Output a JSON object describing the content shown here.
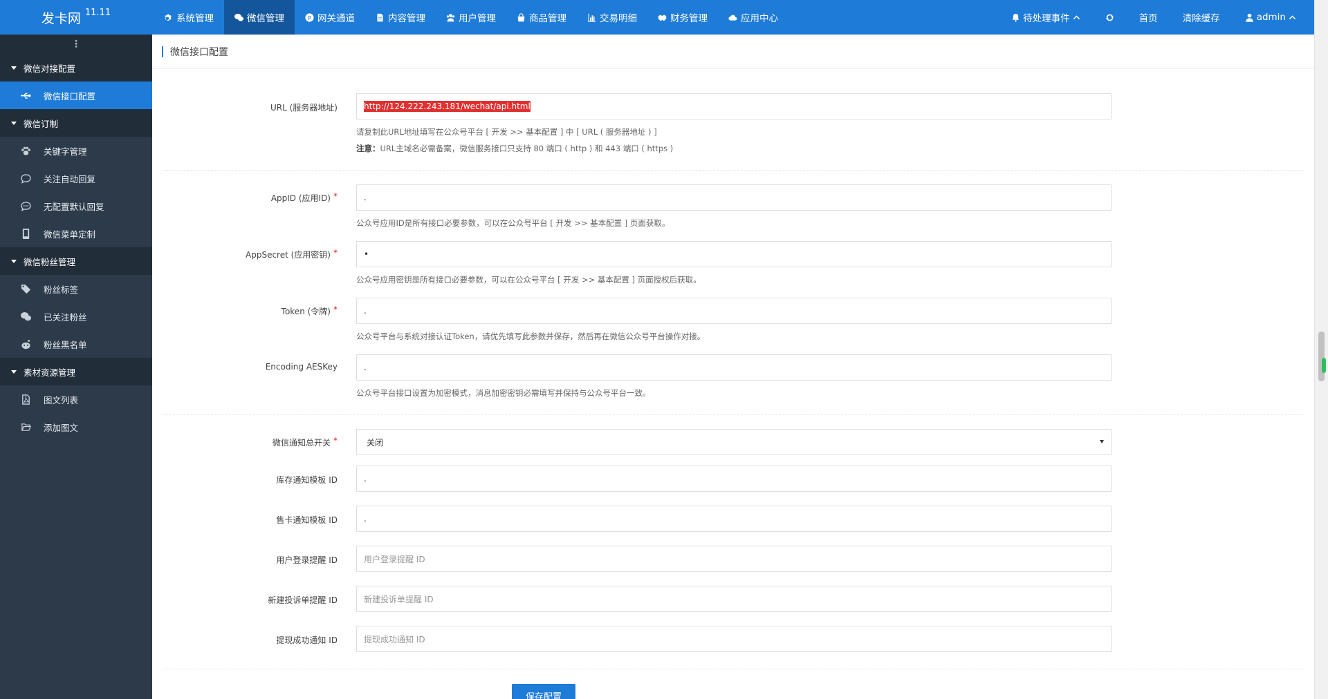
{
  "brand": {
    "name": "发卡网",
    "version": "11.11"
  },
  "topnav": [
    {
      "label": "系统管理",
      "icon": "gear-icon"
    },
    {
      "label": "微信管理",
      "icon": "wechat-icon",
      "active": true
    },
    {
      "label": "网关通道",
      "icon": "paypal-icon"
    },
    {
      "label": "内容管理",
      "icon": "file-text-icon"
    },
    {
      "label": "用户管理",
      "icon": "users-icon"
    },
    {
      "label": "商品管理",
      "icon": "shopping-bag-icon"
    },
    {
      "label": "交易明细",
      "icon": "bar-chart-icon"
    },
    {
      "label": "财务管理",
      "icon": "handshake-icon"
    },
    {
      "label": "应用中心",
      "icon": "cloud-icon"
    }
  ],
  "rightnav": {
    "pending": "待处理事件",
    "home": "首页",
    "clear_cache": "清除缓存",
    "user": "admin"
  },
  "sidebar": {
    "toggle": "⋮",
    "groups": [
      {
        "label": "微信对接配置",
        "items": [
          {
            "label": "微信接口配置",
            "icon": "usb-icon",
            "active": true
          }
        ]
      },
      {
        "label": "微信订制",
        "items": [
          {
            "label": "关键字管理",
            "icon": "paw-icon"
          },
          {
            "label": "关注自动回复",
            "icon": "comment-icon"
          },
          {
            "label": "无配置默认回复",
            "icon": "comment-dots-icon"
          },
          {
            "label": "微信菜单定制",
            "icon": "mobile-icon"
          }
        ]
      },
      {
        "label": "微信粉丝管理",
        "items": [
          {
            "label": "粉丝标签",
            "icon": "tags-icon"
          },
          {
            "label": "已关注粉丝",
            "icon": "wechat-icon"
          },
          {
            "label": "粉丝黑名单",
            "icon": "reddit-icon"
          }
        ]
      },
      {
        "label": "素材资源管理",
        "items": [
          {
            "label": "图文列表",
            "icon": "file-pdf-icon"
          },
          {
            "label": "添加图文",
            "icon": "folder-open-icon"
          }
        ]
      }
    ]
  },
  "page": {
    "title": "微信接口配置"
  },
  "form": {
    "url": {
      "label": "URL (服务器地址)",
      "value": "http://124.222.243.181/wechat/api.html",
      "help1": "请复制此URL地址填写在公众号平台 [ 开发 >> 基本配置 ] 中 [ URL ( 服务器地址 ) ]",
      "help2_bold": "注意：",
      "help2": "URL主域名必需备案，微信服务接口只支持 80 端口 ( http ) 和 443 端口 ( https )"
    },
    "appid": {
      "label": "AppID (应用ID)",
      "value": ".",
      "help": "公众号应用ID是所有接口必要参数，可以在公众号平台 [ 开发 >> 基本配置 ] 页面获取。"
    },
    "appsecret": {
      "label": "AppSecret (应用密钥)",
      "value": "•",
      "help": "公众号应用密钥是所有接口必要参数，可以在公众号平台 [ 开发 >> 基本配置 ] 页面授权后获取。"
    },
    "token": {
      "label": "Token (令牌)",
      "value": ".",
      "help": "公众号平台与系统对接认证Token，请优先填写此参数并保存，然后再在微信公众号平台操作对接。"
    },
    "aeskey": {
      "label": "Encoding AESKey",
      "value": ".",
      "help": "公众号平台接口设置为加密模式，消息加密密钥必需填写并保持与公众号平台一致。"
    },
    "notify_switch": {
      "label": "微信通知总开关",
      "value": "关闭"
    },
    "stock_tpl": {
      "label": "库存通知模板 ID",
      "value": "."
    },
    "sale_tpl": {
      "label": "售卡通知模板 ID",
      "value": "."
    },
    "login_tpl": {
      "label": "用户登录提醒 ID",
      "placeholder": "用户登录提醒 ID"
    },
    "complaint_tpl": {
      "label": "新建投诉单提醒 ID",
      "placeholder": "新建投诉单提醒 ID"
    },
    "withdraw_tpl": {
      "label": "提现成功通知 ID",
      "placeholder": "提现成功通知 ID"
    },
    "required_mark": "*",
    "save": "保存配置"
  }
}
